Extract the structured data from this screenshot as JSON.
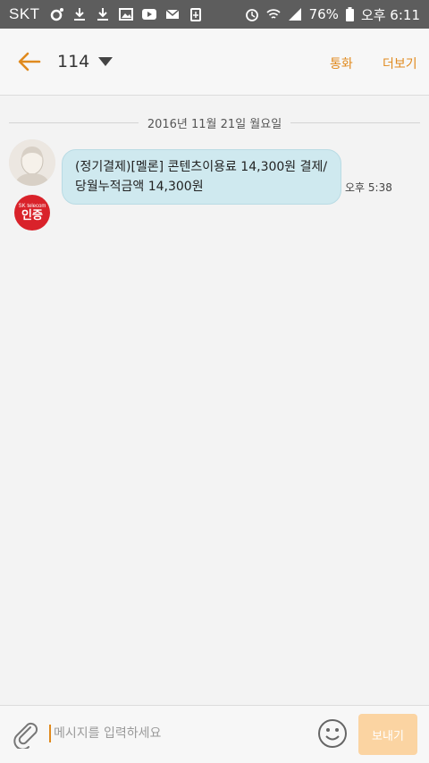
{
  "status_bar": {
    "carrier": "SKT",
    "battery": "76%",
    "time": "오후 6:11",
    "icons": [
      "circle-icon",
      "download-icon",
      "download-icon",
      "image-icon",
      "youtube-icon",
      "mail-icon",
      "battery-saver-icon",
      "alarm-icon",
      "wifi-icon",
      "signal-icon",
      "battery-icon"
    ]
  },
  "header": {
    "contact": "114",
    "call_label": "통화",
    "more_label": "더보기",
    "icons": [
      "back-arrow-icon",
      "dropdown-caret-icon"
    ]
  },
  "conversation": {
    "date": "2016년 11월 21일 월요일",
    "message": {
      "text": "(정기결제)[멜론] 콘텐츠이용료 14,300원 결제/\n당월누적금액 14,300원",
      "time": "오후 5:38"
    },
    "badge": {
      "line1": "SK telecom",
      "line2": "인증"
    }
  },
  "composer": {
    "placeholder": "메시지를 입력하세요",
    "send_label": "보내기",
    "icons": [
      "paperclip-icon",
      "emoji-icon"
    ]
  },
  "colors": {
    "accent": "#e08a1e",
    "bubble": "#cfe9ef",
    "send_disabled": "#fbd4a2",
    "status_bar": "#5d5d5d",
    "badge": "#d9222a"
  }
}
